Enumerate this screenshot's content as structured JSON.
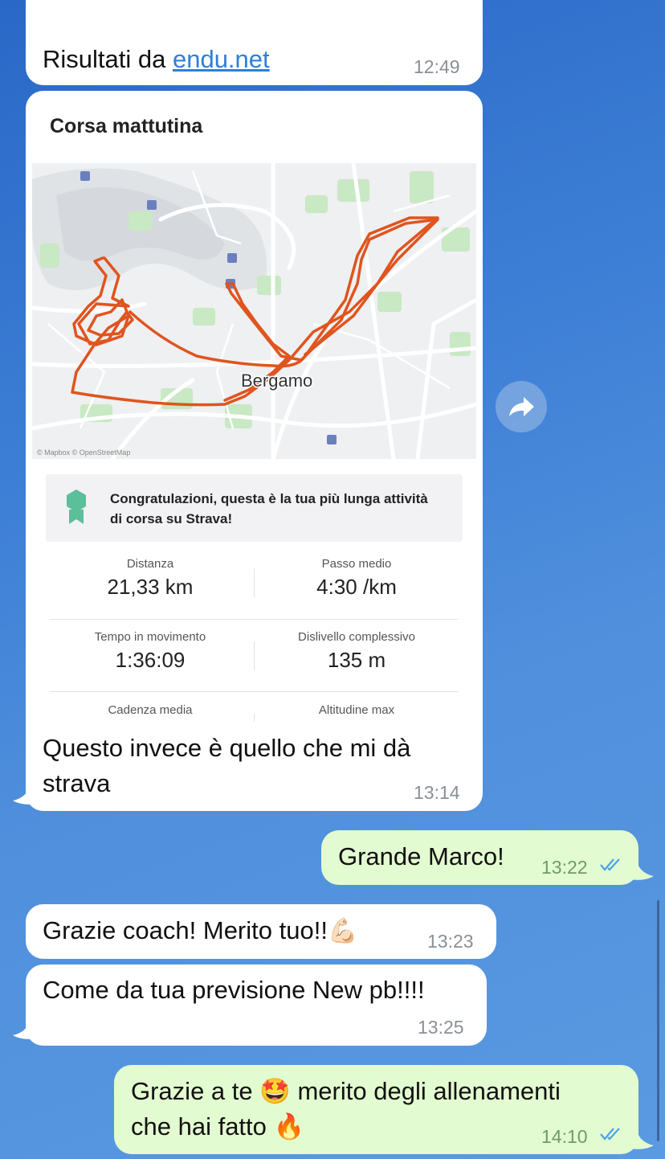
{
  "messages": {
    "m1": {
      "text": "Risultati da ",
      "link": "endu.net",
      "time": "12:49"
    },
    "card": {
      "title": "Corsa mattutina",
      "map_city": "Bergamo",
      "map_credit": "© Mapbox © OpenStreetMap",
      "achievement": "Congratulazioni, questa è la tua più lunga attività di corsa su Strava!",
      "achievement_line1": "Congratulazioni, questa è la tua più lunga attività",
      "achievement_line2": "di corsa su Strava!",
      "stats": [
        {
          "label": "Distanza",
          "value": "21,33 km"
        },
        {
          "label": "Passo medio",
          "value": "4:30 /km"
        },
        {
          "label": "Tempo in movimento",
          "value": "1:36:09"
        },
        {
          "label": "Dislivello complessivo",
          "value": "135 m"
        },
        {
          "label": "Cadenza media",
          "value": ""
        },
        {
          "label": "Altitudine max",
          "value": ""
        }
      ],
      "caption_line1": "Questo invece è quello che mi dà",
      "caption_line2": "strava",
      "time": "13:14"
    },
    "m3": {
      "text": "Grande Marco!",
      "time": "13:22"
    },
    "m4": {
      "text": "Grazie coach! Merito tuo!!",
      "emoji": "💪🏻",
      "time": "13:23"
    },
    "m5": {
      "text": "Come da tua previsione New pb!!!!",
      "time": "13:25"
    },
    "m6": {
      "line1_a": "Grazie a te",
      "emoji1": "🤩",
      "line1_b": "merito degli allenamenti",
      "line2": "che hai fatto",
      "emoji2": "🔥",
      "time": "14:10"
    }
  },
  "colors": {
    "incoming": "#ffffff",
    "outgoing": "#e3fbd0",
    "route": "#e0541e",
    "read_ticks": "#4aa3e8"
  },
  "icons": {
    "forward": "forward-arrow-icon",
    "read": "double-check-icon",
    "medal": "medal-icon"
  }
}
